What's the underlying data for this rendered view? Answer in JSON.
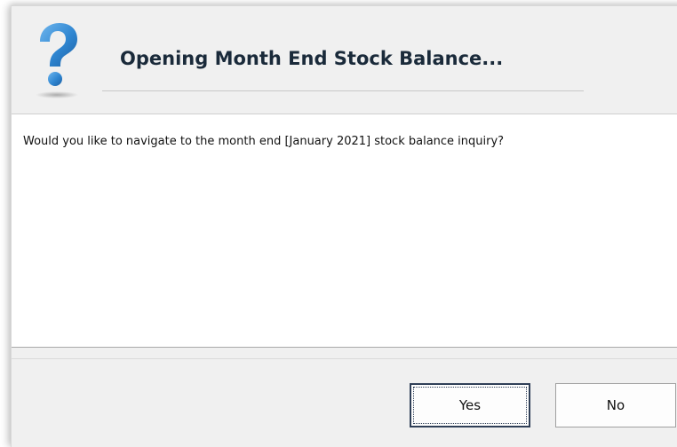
{
  "dialog": {
    "icon": "question-mark-icon",
    "title": "Opening Month End Stock Balance...",
    "message": "Would you like to navigate to the month end [January 2021] stock balance inquiry?",
    "buttons": {
      "yes_label": "Yes",
      "no_label": "No"
    },
    "colors": {
      "icon_blue": "#2f86d1",
      "focus_border": "#2f3f57",
      "panel_bg": "#f0f0f0"
    }
  }
}
